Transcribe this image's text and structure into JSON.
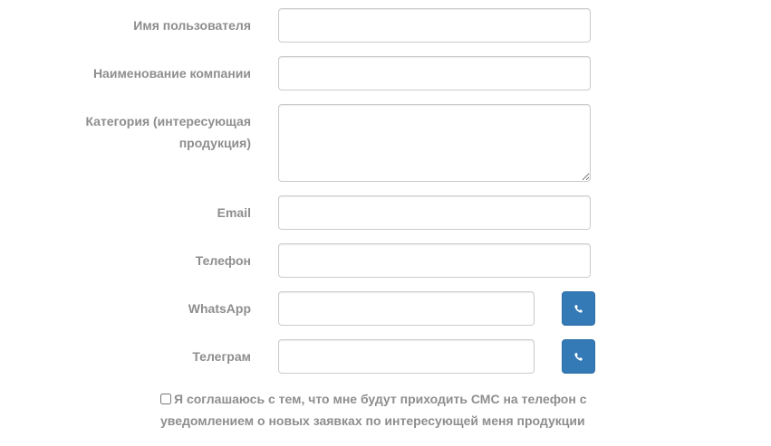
{
  "form": {
    "username": {
      "label": "Имя пользователя",
      "value": ""
    },
    "company": {
      "label": "Наименование компании",
      "value": ""
    },
    "category": {
      "label": "Категория (интересующая продукция)",
      "value": ""
    },
    "email": {
      "label": "Email",
      "value": ""
    },
    "phone": {
      "label": "Телефон",
      "value": ""
    },
    "whatsapp": {
      "label": "WhatsApp",
      "value": "",
      "button_icon": "phone-icon"
    },
    "telegram": {
      "label": "Телеграм",
      "value": "",
      "button_icon": "phone-icon"
    },
    "agreement": {
      "checked": false,
      "text": "Я соглашаюсь с тем, что мне будут приходить СМС на телефон с уведомлением о новых заявках по интересующей меня продукции"
    }
  },
  "colors": {
    "button": "#337ab7",
    "label": "#8e8e8e",
    "border": "#cccccc"
  }
}
